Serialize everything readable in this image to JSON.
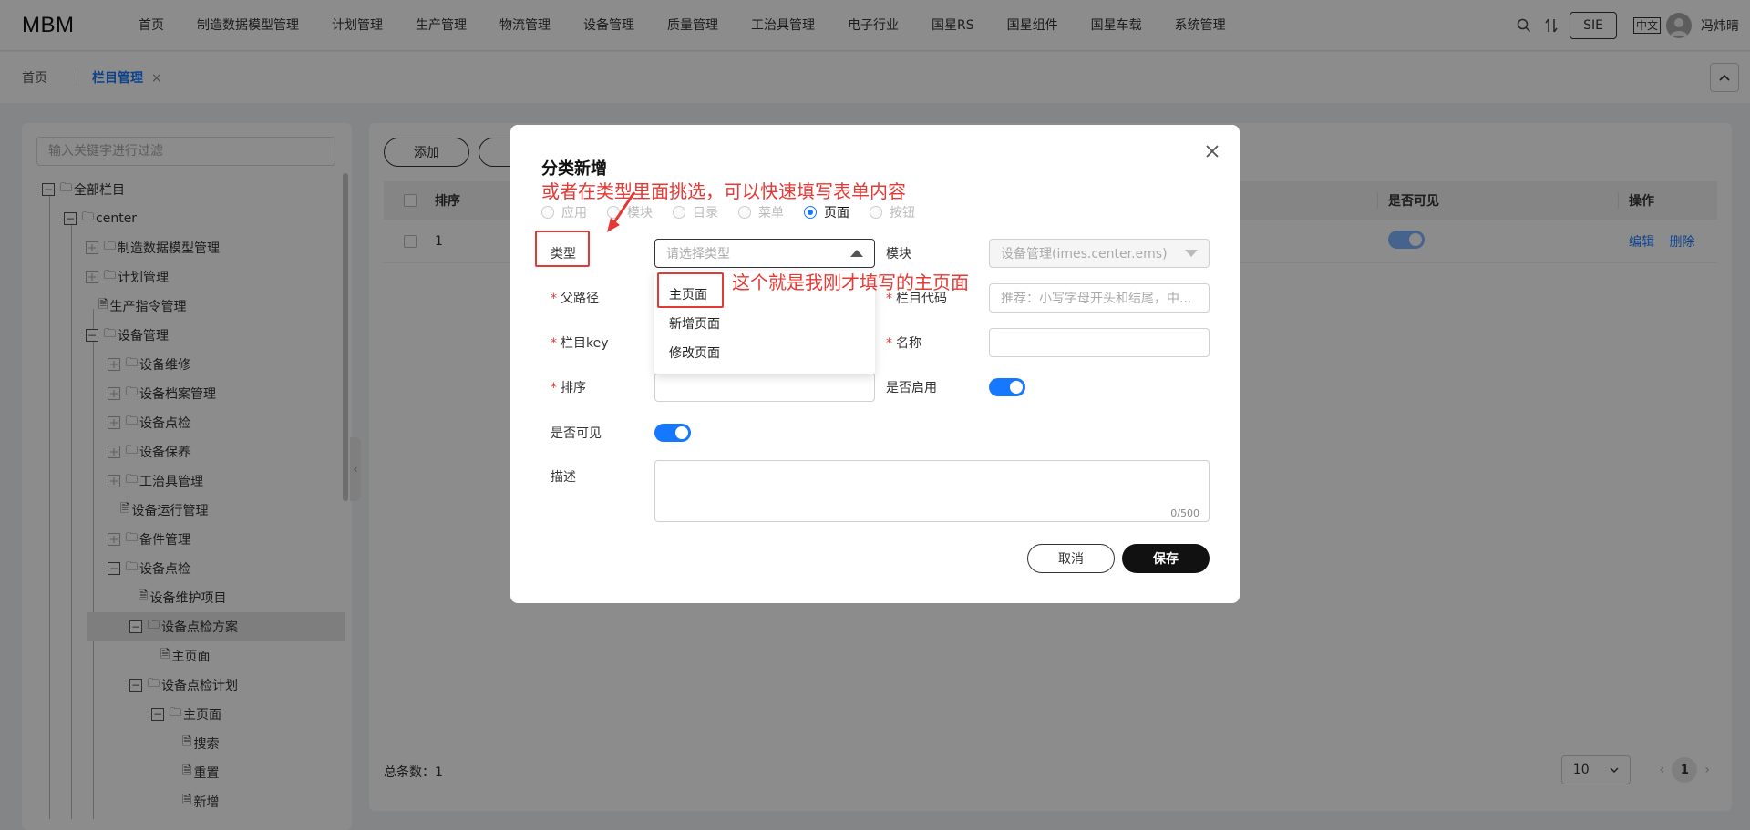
{
  "app": {
    "logo": "MBM"
  },
  "nav": {
    "items": [
      "首页",
      "制造数据模型管理",
      "计划管理",
      "生产管理",
      "物流管理",
      "设备管理",
      "质量管理",
      "工治具管理",
      "电子行业",
      "国星RS",
      "国星组件",
      "国星车载",
      "系统管理"
    ],
    "sie": "SIE",
    "lang": "中文",
    "user": "冯炜晴"
  },
  "tabs": {
    "home": "首页",
    "active": "栏目管理",
    "close": "×"
  },
  "tree": {
    "placeholder": "输入关键字进行过滤",
    "nodes": [
      "全部栏目",
      "center",
      "制造数据模型管理",
      "计划管理",
      "生产指令管理",
      "设备管理",
      "设备维修",
      "设备档案管理",
      "设备点检",
      "设备保养",
      "工治具管理",
      "设备运行管理",
      "备件管理",
      "设备点检",
      "设备维护项目",
      "设备点检方案",
      "主页面",
      "设备点检计划",
      "主页面",
      "搜索",
      "重置",
      "新增"
    ]
  },
  "main": {
    "add_button": "添加",
    "columns": {
      "sort": "排序",
      "visible": "是否可见",
      "actions": "操作"
    },
    "row": {
      "sort": "1",
      "edit": "编辑",
      "delete": "删除"
    },
    "total": "总条数：1",
    "page_size": "10",
    "current_page": "1"
  },
  "modal": {
    "title": "分类新增",
    "annotation_top": "或者在类型里面挑选，可以快速填写表单内容",
    "annotation_right": "这个就是我刚才填写的主页面",
    "radios": [
      "应用",
      "模块",
      "目录",
      "菜单",
      "页面",
      "按钮"
    ],
    "checked_radio": "页面",
    "fields": {
      "type_label": "类型",
      "type_placeholder": "请选择类型",
      "module_label": "模块",
      "module_value": "设备管理(imes.center.ems)",
      "parent_label": "父路径",
      "code_label": "栏目代码",
      "code_placeholder": "推荐：小写字母开头和结尾，中...",
      "key_label": "栏目key",
      "name_label": "名称",
      "sort_label": "排序",
      "enabled_label": "是否启用",
      "visible_label": "是否可见",
      "desc_label": "描述",
      "desc_counter": "0/500"
    },
    "dropdown_options": [
      "主页面",
      "新增页面",
      "修改页面"
    ],
    "cancel": "取消",
    "save": "保存"
  },
  "colors": {
    "accent": "#1677ff",
    "annotation": "#e53935"
  }
}
